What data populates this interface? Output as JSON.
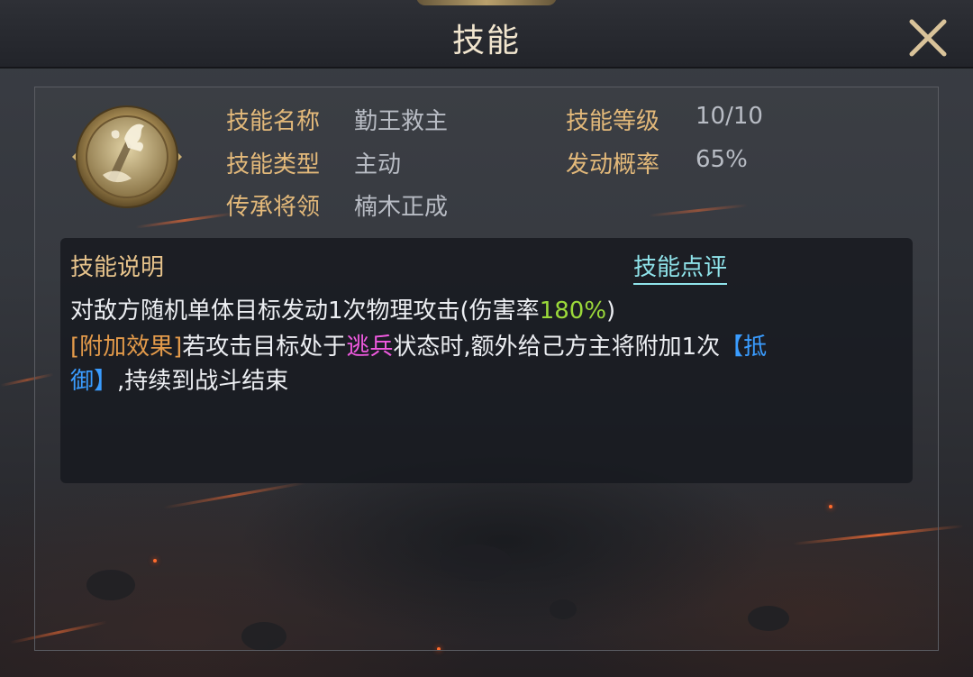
{
  "header": {
    "title": "技能"
  },
  "skill": {
    "name_label": "技能名称",
    "name_value": "勤王救主",
    "level_label": "技能等级",
    "level_value": "10/10",
    "type_label": "技能类型",
    "type_value": "主动",
    "chance_label": "发动概率",
    "chance_value": "65%",
    "inherit_label": "传承将领",
    "inherit_value": "楠木正成",
    "icon": "flame-sword-skill-icon"
  },
  "description": {
    "title": "技能说明",
    "review_link": "技能点评",
    "line1_prefix": "对敌方随机单体目标发动1次物理攻击(伤害率",
    "line1_rate": "180%",
    "line1_suffix": ")",
    "line2_tag": "[附加效果]",
    "line2_text": "若攻击目标处于",
    "line2_status": "逃兵",
    "line2_text2": "状态时,额外给己方主将附加1次",
    "line2_buff_part1": "【抵",
    "line3_buff_part2": "御】",
    "line3_text": ",持续到战斗结束"
  },
  "colors": {
    "label": "#e3b97a",
    "value": "#b8bcc4",
    "rate": "#9bd93a",
    "tag": "#e39a4a",
    "status": "#f05ae0",
    "buff": "#3a9cff",
    "link": "#8fe3ea"
  },
  "icons": {
    "close": "close-icon"
  }
}
